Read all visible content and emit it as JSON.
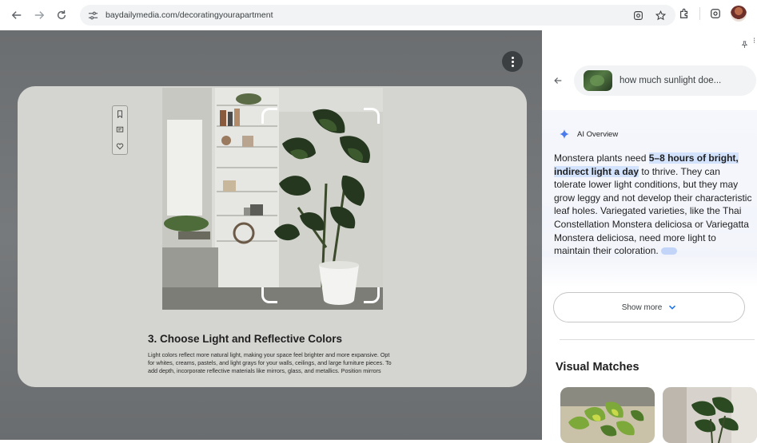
{
  "browser": {
    "url": "baydailymedia.com/decoratingyourapartment"
  },
  "article": {
    "title": "3. Choose Light and Reflective Colors",
    "body": "Light colors reflect more natural light, making your space feel brighter and more expansive. Opt for whites, creams, pastels, and light grays for your walls, ceilings, and large furniture pieces. To add depth, incorporate reflective materials like mirrors, glass, and metallics. Position mirrors"
  },
  "side_panel": {
    "query": "how much sunlight doe...",
    "ai_overview_label": "AI Overview",
    "ai_text": {
      "before": "Monstera plants need ",
      "highlight": "5–8 hours of bright, indirect light a day",
      "after": " to thrive. They can tolerate lower light conditions, but they may grow leggy and not develop their characteristic leaf holes. Variegated varieties, like the Thai Constellation Monstera deliciosa or Variegatta Monstera deliciosa, need more light to maintain their coloration."
    },
    "show_more_label": "Show more",
    "visual_matches_title": "Visual Matches"
  },
  "colors": {
    "accent": "#1a73e8",
    "highlight": "#d3e3fd",
    "overlay": "#6b6e70"
  }
}
